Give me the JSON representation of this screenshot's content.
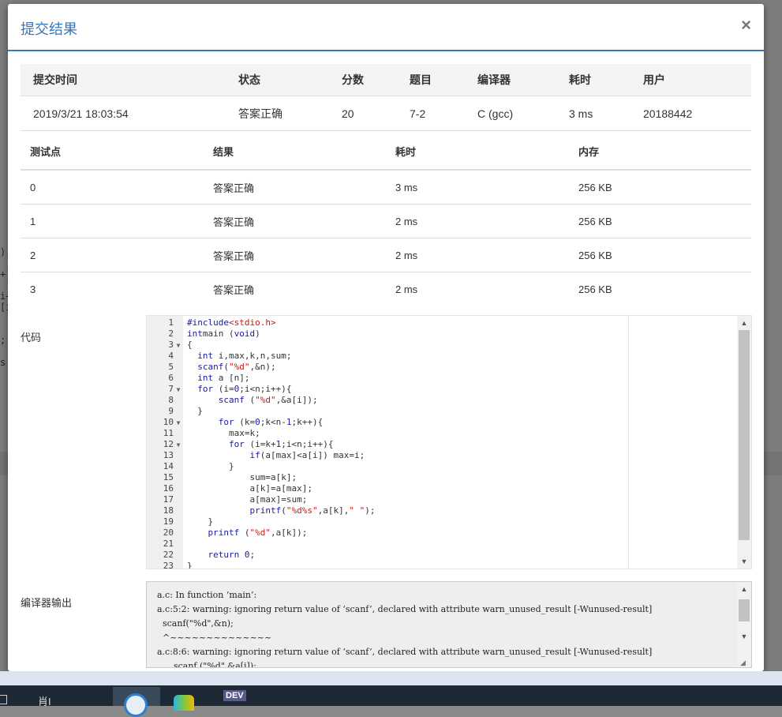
{
  "modal": {
    "title": "提交结果",
    "close": "×"
  },
  "summary": {
    "headers": [
      "提交时间",
      "状态",
      "分数",
      "题目",
      "编译器",
      "耗时",
      "用户"
    ],
    "row": {
      "time": "2019/3/21 18:03:54",
      "status": "答案正确",
      "score": "20",
      "problem": "7-2",
      "compiler": "C (gcc)",
      "elapsed": "3 ms",
      "user": "20188442"
    }
  },
  "cases": {
    "headers": [
      "测试点",
      "结果",
      "耗时",
      "内存"
    ],
    "rows": [
      {
        "id": "0",
        "result": "答案正确",
        "time": "3 ms",
        "memory": "256 KB"
      },
      {
        "id": "1",
        "result": "答案正确",
        "time": "2 ms",
        "memory": "256 KB"
      },
      {
        "id": "2",
        "result": "答案正确",
        "time": "2 ms",
        "memory": "256 KB"
      },
      {
        "id": "3",
        "result": "答案正确",
        "time": "2 ms",
        "memory": "256 KB"
      }
    ]
  },
  "code": {
    "label": "代码",
    "lines": [
      {
        "n": "1",
        "fold": false,
        "tokens": [
          [
            "kw",
            "#include"
          ],
          [
            "str",
            "<stdio.h>"
          ]
        ]
      },
      {
        "n": "2",
        "fold": false,
        "tokens": [
          [
            "kw",
            "int"
          ],
          [
            "",
            "main "
          ],
          [
            "",
            "("
          ],
          [
            "kw",
            "void"
          ],
          [
            "",
            ")"
          ]
        ]
      },
      {
        "n": "3",
        "fold": true,
        "tokens": [
          [
            "",
            "{"
          ]
        ]
      },
      {
        "n": "4",
        "fold": false,
        "tokens": [
          [
            "",
            "  "
          ],
          [
            "kw",
            "int"
          ],
          [
            "",
            " i,max,k,n,sum;"
          ]
        ]
      },
      {
        "n": "5",
        "fold": false,
        "tokens": [
          [
            "",
            "  "
          ],
          [
            "kw",
            "scanf"
          ],
          [
            "",
            "("
          ],
          [
            "str",
            "\"%d\""
          ],
          [
            "",
            ",&n);"
          ]
        ]
      },
      {
        "n": "6",
        "fold": false,
        "tokens": [
          [
            "",
            "  "
          ],
          [
            "kw",
            "int"
          ],
          [
            "",
            ""
          ],
          [
            "",
            " a [n];"
          ]
        ]
      },
      {
        "n": "7",
        "fold": true,
        "tokens": [
          [
            "",
            "  "
          ],
          [
            "kw",
            "for"
          ],
          [
            "",
            " (i="
          ],
          [
            "num",
            "0"
          ],
          [
            "",
            ";i<n;i++){"
          ]
        ]
      },
      {
        "n": "8",
        "fold": false,
        "tokens": [
          [
            "",
            "      "
          ],
          [
            "kw",
            "scanf"
          ],
          [
            "",
            " ("
          ],
          [
            "str",
            "\"%d\""
          ],
          [
            "",
            ",&a[i]);"
          ]
        ]
      },
      {
        "n": "9",
        "fold": false,
        "tokens": [
          [
            "",
            "  }"
          ]
        ]
      },
      {
        "n": "10",
        "fold": true,
        "tokens": [
          [
            "",
            "      "
          ],
          [
            "kw",
            "for"
          ],
          [
            "",
            " (k="
          ],
          [
            "num",
            "0"
          ],
          [
            "",
            ";k<n-"
          ],
          [
            "num",
            "1"
          ],
          [
            "",
            ";k++){"
          ]
        ]
      },
      {
        "n": "11",
        "fold": false,
        "tokens": [
          [
            "",
            "        max=k;"
          ]
        ]
      },
      {
        "n": "12",
        "fold": true,
        "tokens": [
          [
            "",
            "        "
          ],
          [
            "kw",
            "for"
          ],
          [
            "",
            " (i=k+"
          ],
          [
            "num",
            "1"
          ],
          [
            "",
            ";i<n;i++){"
          ]
        ]
      },
      {
        "n": "13",
        "fold": false,
        "tokens": [
          [
            "",
            "            "
          ],
          [
            "kw",
            "if"
          ],
          [
            "",
            "(a[max]<a[i]) max=i;"
          ]
        ]
      },
      {
        "n": "14",
        "fold": false,
        "tokens": [
          [
            "",
            "        }"
          ]
        ]
      },
      {
        "n": "15",
        "fold": false,
        "tokens": [
          [
            "",
            "            sum=a[k];"
          ]
        ]
      },
      {
        "n": "16",
        "fold": false,
        "tokens": [
          [
            "",
            "            a[k]=a[max];"
          ]
        ]
      },
      {
        "n": "17",
        "fold": false,
        "tokens": [
          [
            "",
            "            a[max]=sum;"
          ]
        ]
      },
      {
        "n": "18",
        "fold": false,
        "tokens": [
          [
            "",
            "            "
          ],
          [
            "kw",
            "printf"
          ],
          [
            "",
            "("
          ],
          [
            "str",
            "\"%d%s\""
          ],
          [
            "",
            ",a[k],"
          ],
          [
            "str",
            "\" \""
          ],
          [
            "",
            ");"
          ]
        ]
      },
      {
        "n": "19",
        "fold": false,
        "tokens": [
          [
            "",
            "    }"
          ]
        ]
      },
      {
        "n": "20",
        "fold": false,
        "tokens": [
          [
            "",
            "    "
          ],
          [
            "kw",
            "printf"
          ],
          [
            "",
            " ("
          ],
          [
            "str",
            "\"%d\""
          ],
          [
            "",
            ",a[k]);"
          ]
        ]
      },
      {
        "n": "21",
        "fold": false,
        "tokens": [
          [
            "",
            ""
          ]
        ]
      },
      {
        "n": "22",
        "fold": false,
        "tokens": [
          [
            "",
            "    "
          ],
          [
            "kw",
            "return"
          ],
          [
            "",
            " "
          ],
          [
            "num",
            "0"
          ],
          [
            "",
            ";"
          ]
        ]
      },
      {
        "n": "23",
        "fold": false,
        "tokens": [
          [
            "",
            "}"
          ]
        ]
      }
    ]
  },
  "compiler_output": {
    "label": "编译器输出",
    "text": "a.c: In function ‘main’:\na.c:5:2: warning: ignoring return value of ‘scanf’, declared with attribute warn_unused_result [-Wunused-result]\n  scanf(\"%d\",&n);\n  ^~~~~~~~~~~~~~~\na.c:8:6: warning: ignoring return value of ‘scanf’, declared with attribute warn_unused_result [-Wunused-result]\n      scanf (\"%d\",&a[i]);"
  },
  "taskbar": {
    "item_text": "肖I",
    "app_label": "DEV"
  },
  "backdrop": {
    "code_fragment": ");\n\n+)\n\ni+\n[i\n\n\n;\n\ns'"
  }
}
